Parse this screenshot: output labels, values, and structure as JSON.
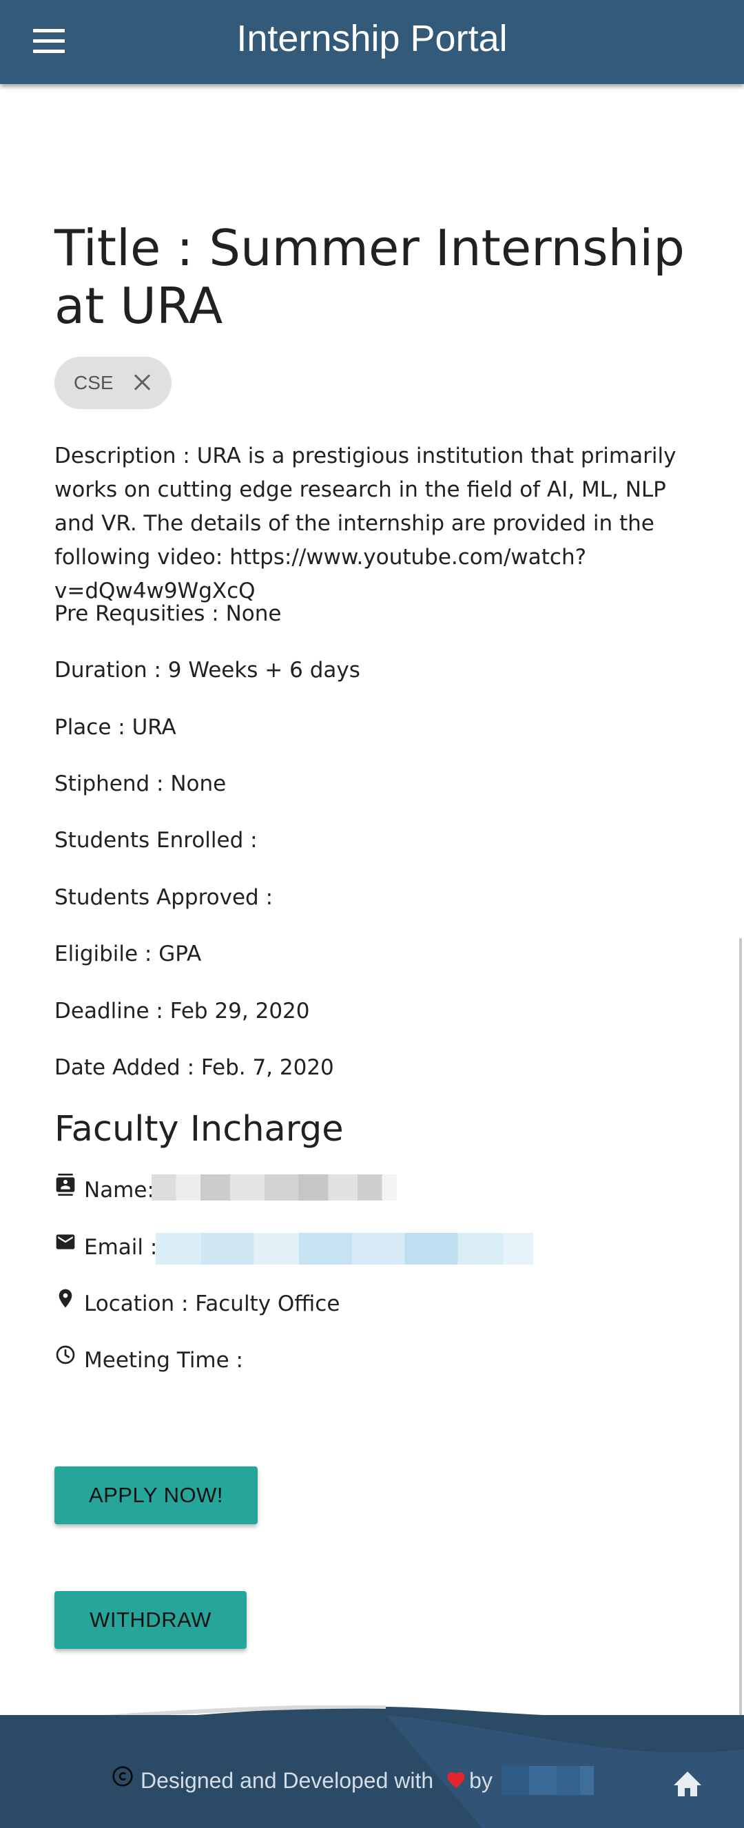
{
  "app": {
    "title": "Internship Portal"
  },
  "internship": {
    "title": "Title : Summer Internship at URA",
    "tag": "CSE",
    "description": "Description : URA is a prestigious institution that primarily works on cutting edge research in the field of AI, ML, NLP and VR. The details of the internship are provided in the following video: https://www.youtube.com/watch?v=dQw4w9WgXcQ",
    "prerequisites": "Pre Requsities : None",
    "duration": "Duration : 9 Weeks + 6 days",
    "place": "Place : URA",
    "stipend": "Stiphend : None",
    "students_enrolled": "Students Enrolled :",
    "students_approved": "Students Approved :",
    "eligible": "Eligibile : GPA",
    "deadline": "Deadline : Feb 29, 2020",
    "date_added": "Date Added : Feb. 7, 2020"
  },
  "faculty": {
    "heading": "Faculty Incharge",
    "name_label": "Name:",
    "email_label": "Email :",
    "location": "Location : Faculty Office",
    "meeting_time": "Meeting Time :"
  },
  "actions": {
    "apply_label": "APPLY NOW!",
    "withdraw_label": "WITHDRAW"
  },
  "footer": {
    "credit_text": "Designed and Developed with",
    "by_text": "by"
  },
  "colors": {
    "appbar": "#345a7a",
    "button": "#26a69a",
    "footer": "#2b4a66",
    "heart": "#e3262e"
  }
}
